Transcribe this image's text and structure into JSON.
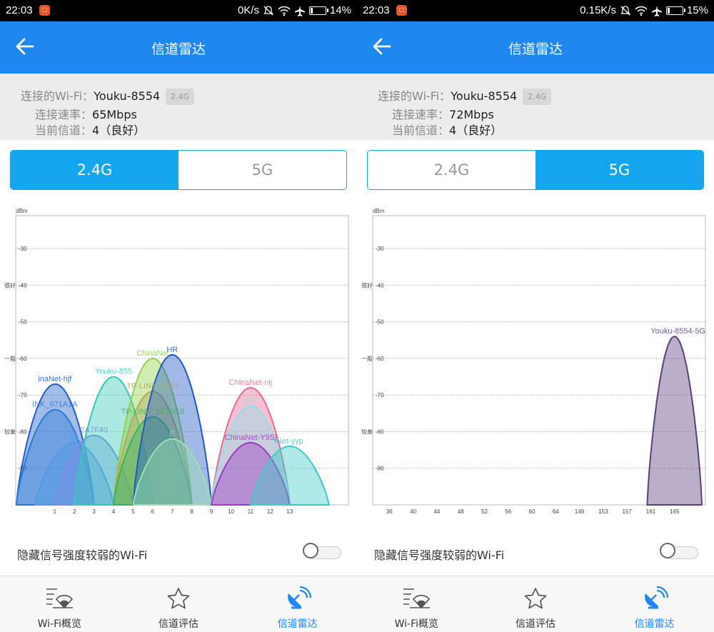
{
  "colors": {
    "accent": "#1e88f0",
    "tab_active": "#13a6ef"
  },
  "screens": [
    {
      "status": {
        "time": "22:03",
        "notif_glyph": "□",
        "speed": "0K/s",
        "battery": "14%",
        "battery_level": 0.14
      },
      "appbar": {
        "title": "信道雷达",
        "back_icon": "arrow-left-icon"
      },
      "info": {
        "wifi_label": "连接的Wi-Fi：",
        "wifi_name": "Youku-8554",
        "band_badge": "2.4G",
        "speed_label": "连接速率：",
        "speed_value": "65Mbps",
        "channel_label": "当前信道：",
        "channel_value": "4（良好）"
      },
      "tabs": [
        {
          "label": "2.4G",
          "active": true
        },
        {
          "label": "5G",
          "active": false
        }
      ],
      "chart_data": {
        "type": "area",
        "unit_label": "dBm",
        "ylim": [
          -100,
          -21
        ],
        "y_ticks": [
          "-30",
          "-40",
          "-50",
          "-60",
          "-70",
          "-80",
          "-90"
        ],
        "zone_labels": [
          {
            "text": "很好",
            "y": -40
          },
          {
            "text": "一般",
            "y": -60
          },
          {
            "text": "较差",
            "y": -80
          }
        ],
        "x_ticks": [
          "1",
          "2",
          "3",
          "4",
          "5",
          "6",
          "7",
          "8",
          "9",
          "10",
          "11",
          "12",
          "13"
        ],
        "x_domain": [
          -1,
          16
        ],
        "series": [
          {
            "name": "inaNet-hjf",
            "center": 1,
            "dbm": -67,
            "color": "#1f5fc7"
          },
          {
            "name": "INK_671A1A",
            "center": 1,
            "dbm": -74,
            "color": "#2a7ad8"
          },
          {
            "name": "da",
            "center": 2,
            "dbm": -83,
            "color": "#4e9be6"
          },
          {
            "name": "2A7F40",
            "center": 3,
            "dbm": -81,
            "color": "#7b8ee3"
          },
          {
            "name": "Youku-855",
            "center": 4,
            "dbm": -65,
            "color": "#37c9b8"
          },
          {
            "name": "ChinaNet",
            "center": 6,
            "dbm": -60,
            "color": "#8fd14a"
          },
          {
            "name": "TP-LINK_F626",
            "center": 6,
            "dbm": -69,
            "color": "#b1a957"
          },
          {
            "name": "TP-LINK_EF26C8",
            "center": 6,
            "dbm": -76,
            "color": "#3bb15f"
          },
          {
            "name": "HR",
            "center": 7,
            "dbm": -59,
            "color": "#2257c6"
          },
          {
            "name": "E",
            "center": 7,
            "dbm": -82,
            "color": "#9ae0b0"
          },
          {
            "name": "ChinaNet-nlj",
            "center": 11,
            "dbm": -68,
            "color": "#e36b95"
          },
          {
            "name": "CX",
            "center": 11,
            "dbm": -73,
            "color": "#8fe0ea"
          },
          {
            "name": "ChinaNet-Y9Sj",
            "center": 11,
            "dbm": -83,
            "color": "#9c3ac2"
          },
          {
            "name": "Net-yyp",
            "center": 13,
            "dbm": -84,
            "color": "#3ecac8"
          }
        ]
      },
      "toggle": {
        "label": "隐藏信号强度较弱的Wi-Fi",
        "on": false
      },
      "nav": [
        {
          "label": "Wi-Fi概览",
          "icon": "wifi-overview-icon",
          "active": false
        },
        {
          "label": "信道评估",
          "icon": "star-icon",
          "active": false
        },
        {
          "label": "信道雷达",
          "icon": "radar-icon",
          "active": true
        }
      ]
    },
    {
      "status": {
        "time": "22:03",
        "notif_glyph": "□",
        "speed": "0.15K/s",
        "battery": "15%",
        "battery_level": 0.15
      },
      "appbar": {
        "title": "信道雷达",
        "back_icon": "arrow-left-icon"
      },
      "info": {
        "wifi_label": "连接的Wi-Fi：",
        "wifi_name": "Youku-8554",
        "band_badge": "2.4G",
        "speed_label": "连接速率：",
        "speed_value": "72Mbps",
        "channel_label": "当前信道：",
        "channel_value": "4（良好）"
      },
      "tabs": [
        {
          "label": "2.4G",
          "active": false
        },
        {
          "label": "5G",
          "active": true
        }
      ],
      "chart_data": {
        "type": "area",
        "unit_label": "dBm",
        "ylim": [
          -100,
          -21
        ],
        "y_ticks": [
          "-30",
          "-40",
          "-50",
          "-60",
          "-70",
          "-80",
          "-90"
        ],
        "zone_labels": [
          {
            "text": "很好",
            "y": -40
          },
          {
            "text": "一般",
            "y": -60
          },
          {
            "text": "较差",
            "y": -80
          }
        ],
        "x_ticks": [
          "36",
          "40",
          "44",
          "48",
          "52",
          "56",
          "60",
          "64",
          "149",
          "153",
          "157",
          "161",
          "165"
        ],
        "x_domain": [
          -0.7,
          13.3
        ],
        "series": [
          {
            "name": "Youku-8554-5G",
            "center": 12,
            "dbm": -54,
            "color": "#5b3f7e"
          }
        ]
      },
      "toggle": {
        "label": "隐藏信号强度较弱的Wi-Fi",
        "on": false
      },
      "nav": [
        {
          "label": "Wi-Fi概览",
          "icon": "wifi-overview-icon",
          "active": false
        },
        {
          "label": "信道评估",
          "icon": "star-icon",
          "active": false
        },
        {
          "label": "信道雷达",
          "icon": "radar-icon",
          "active": true
        }
      ]
    }
  ]
}
